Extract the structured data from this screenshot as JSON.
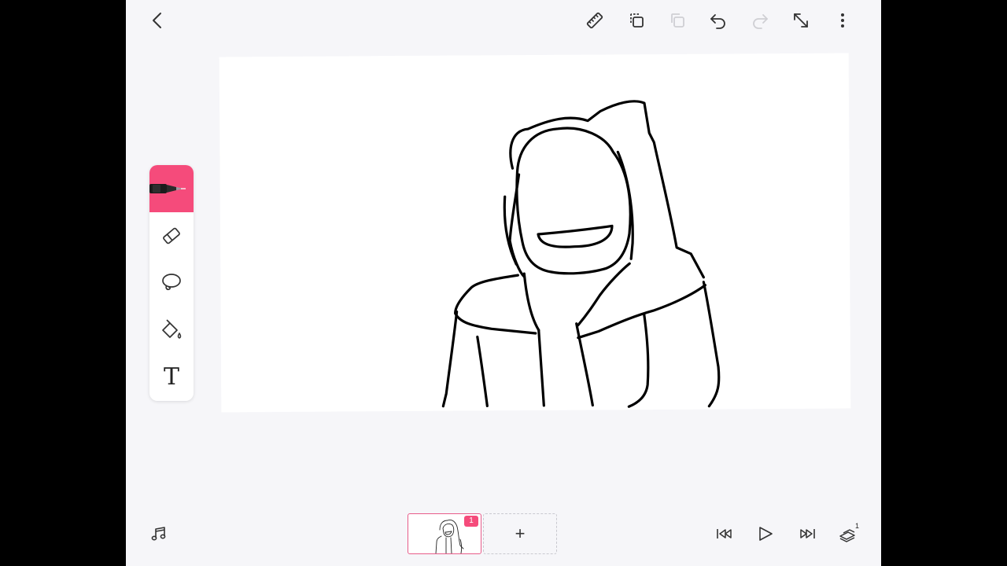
{
  "topbar": {
    "back_icon": "chevron-left-icon",
    "ruler_icon": "ruler-icon",
    "duplicate_icon": "duplicate-icon",
    "paste_icon": "paste-icon",
    "undo_icon": "undo-icon",
    "redo_icon": "redo-icon",
    "resize_icon": "resize-diagonal-icon",
    "more_icon": "more-vertical-icon"
  },
  "tools": [
    {
      "name": "pen",
      "icon": "pen-icon",
      "active": true
    },
    {
      "name": "eraser",
      "icon": "eraser-icon",
      "active": false
    },
    {
      "name": "lasso",
      "icon": "lasso-icon",
      "active": false
    },
    {
      "name": "fill",
      "icon": "paint-bucket-icon",
      "active": false
    },
    {
      "name": "text",
      "icon": "text-icon",
      "label": "T",
      "active": false
    }
  ],
  "timeline": {
    "music_icon": "music-note-icon",
    "frames": [
      {
        "badge": "1",
        "selected": true
      }
    ],
    "add_frame_label": "+",
    "skip_back_icon": "skip-back-icon",
    "play_icon": "play-icon",
    "skip_forward_icon": "skip-forward-icon",
    "layers_icon": "layers-icon",
    "layers_count": "1"
  },
  "colors": {
    "accent": "#f54b7b",
    "background": "#f6f6f9",
    "canvas": "#ffffff",
    "ink": "#000000"
  }
}
